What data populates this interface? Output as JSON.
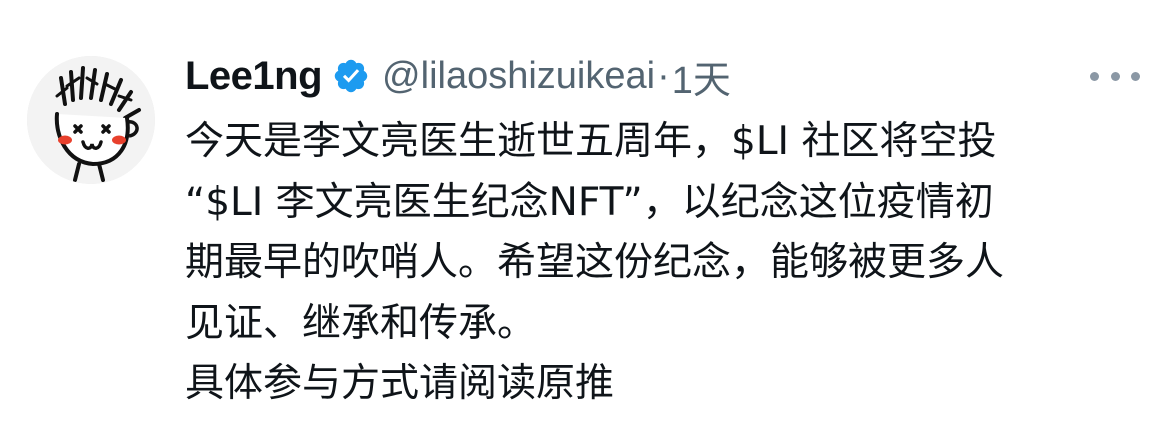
{
  "tweet": {
    "author": {
      "display_name": "Lee1ng",
      "handle": "@lilaoshizuikeai",
      "verified": true,
      "avatar_icon": "cartoon-face-avatar"
    },
    "separator": "·",
    "time": "1天",
    "more_icon": "ellipsis-icon",
    "text_lines": [
      "今天是李文亮医生逝世五周年，$LI 社区将空投",
      "“$LI 李文亮医生纪念NFT”，以纪念这位疫情初",
      "期最早的吹哨人。希望这份纪念，能够被更多人",
      "见证、继承和传承。",
      "具体参与方式请阅读原推"
    ]
  },
  "colors": {
    "text_primary": "#0f1419",
    "text_secondary": "#536471",
    "verified_blue": "#1d9bf0",
    "background": "#ffffff"
  }
}
